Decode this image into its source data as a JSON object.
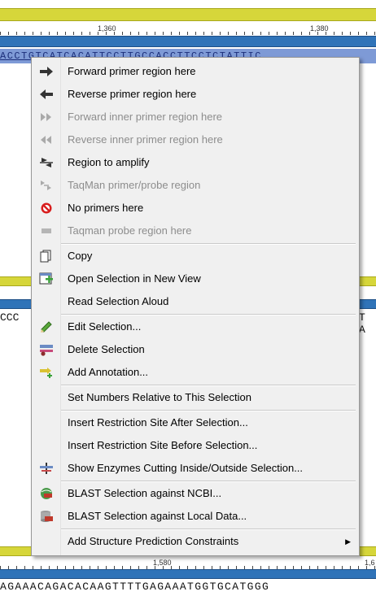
{
  "ruler_top": {
    "labels": [
      "1,360",
      "1,380"
    ]
  },
  "ruler_bottom": {
    "labels": [
      "1,580",
      "1,6"
    ]
  },
  "sequence": {
    "selected_row": "ACCTGTCATCACATTCCTTGCCACCTTCCTCTATTIC",
    "mid_left": "CCC",
    "mid_right": "T A",
    "bottom_row": "AGAAACAGACACAAGTTTTGAGAAATGGTGCATGGG"
  },
  "menu": {
    "items": [
      {
        "label": "Forward primer region here",
        "icon": "forward-arrow-icon",
        "disabled": false
      },
      {
        "label": "Reverse primer region here",
        "icon": "reverse-arrow-icon",
        "disabled": false
      },
      {
        "label": "Forward inner primer region here",
        "icon": "forward-inner-icon",
        "disabled": true
      },
      {
        "label": "Reverse inner primer region here",
        "icon": "reverse-inner-icon",
        "disabled": true
      },
      {
        "label": "Region to amplify",
        "icon": "amplify-icon",
        "disabled": false
      },
      {
        "label": "TaqMan primer/probe region",
        "icon": "taqman-icon",
        "disabled": true
      },
      {
        "label": "No primers here",
        "icon": "no-primers-icon",
        "disabled": false
      },
      {
        "label": "Taqman probe region here",
        "icon": "probe-icon",
        "disabled": true
      },
      {
        "label": "Copy",
        "icon": "copy-icon",
        "disabled": false
      },
      {
        "label": "Open Selection in New View",
        "icon": "new-view-icon",
        "disabled": false
      },
      {
        "label": "Read Selection Aloud",
        "icon": "",
        "disabled": false
      },
      {
        "label": "Edit Selection...",
        "icon": "pencil-icon",
        "disabled": false
      },
      {
        "label": "Delete Selection",
        "icon": "delete-icon",
        "disabled": false
      },
      {
        "label": "Add Annotation...",
        "icon": "annotation-icon",
        "disabled": false
      },
      {
        "label": "Set Numbers Relative to This Selection",
        "icon": "",
        "disabled": false
      },
      {
        "label": "Insert Restriction Site After Selection...",
        "icon": "",
        "disabled": false
      },
      {
        "label": "Insert Restriction Site Before Selection...",
        "icon": "",
        "disabled": false
      },
      {
        "label": "Show Enzymes Cutting Inside/Outside Selection...",
        "icon": "enzymes-icon",
        "disabled": false
      },
      {
        "label": "BLAST Selection against NCBI...",
        "icon": "blast-ncbi-icon",
        "disabled": false
      },
      {
        "label": "BLAST Selection against Local Data...",
        "icon": "blast-local-icon",
        "disabled": false
      },
      {
        "label": "Add Structure Prediction Constraints",
        "icon": "",
        "disabled": false,
        "submenu": true
      }
    ]
  }
}
